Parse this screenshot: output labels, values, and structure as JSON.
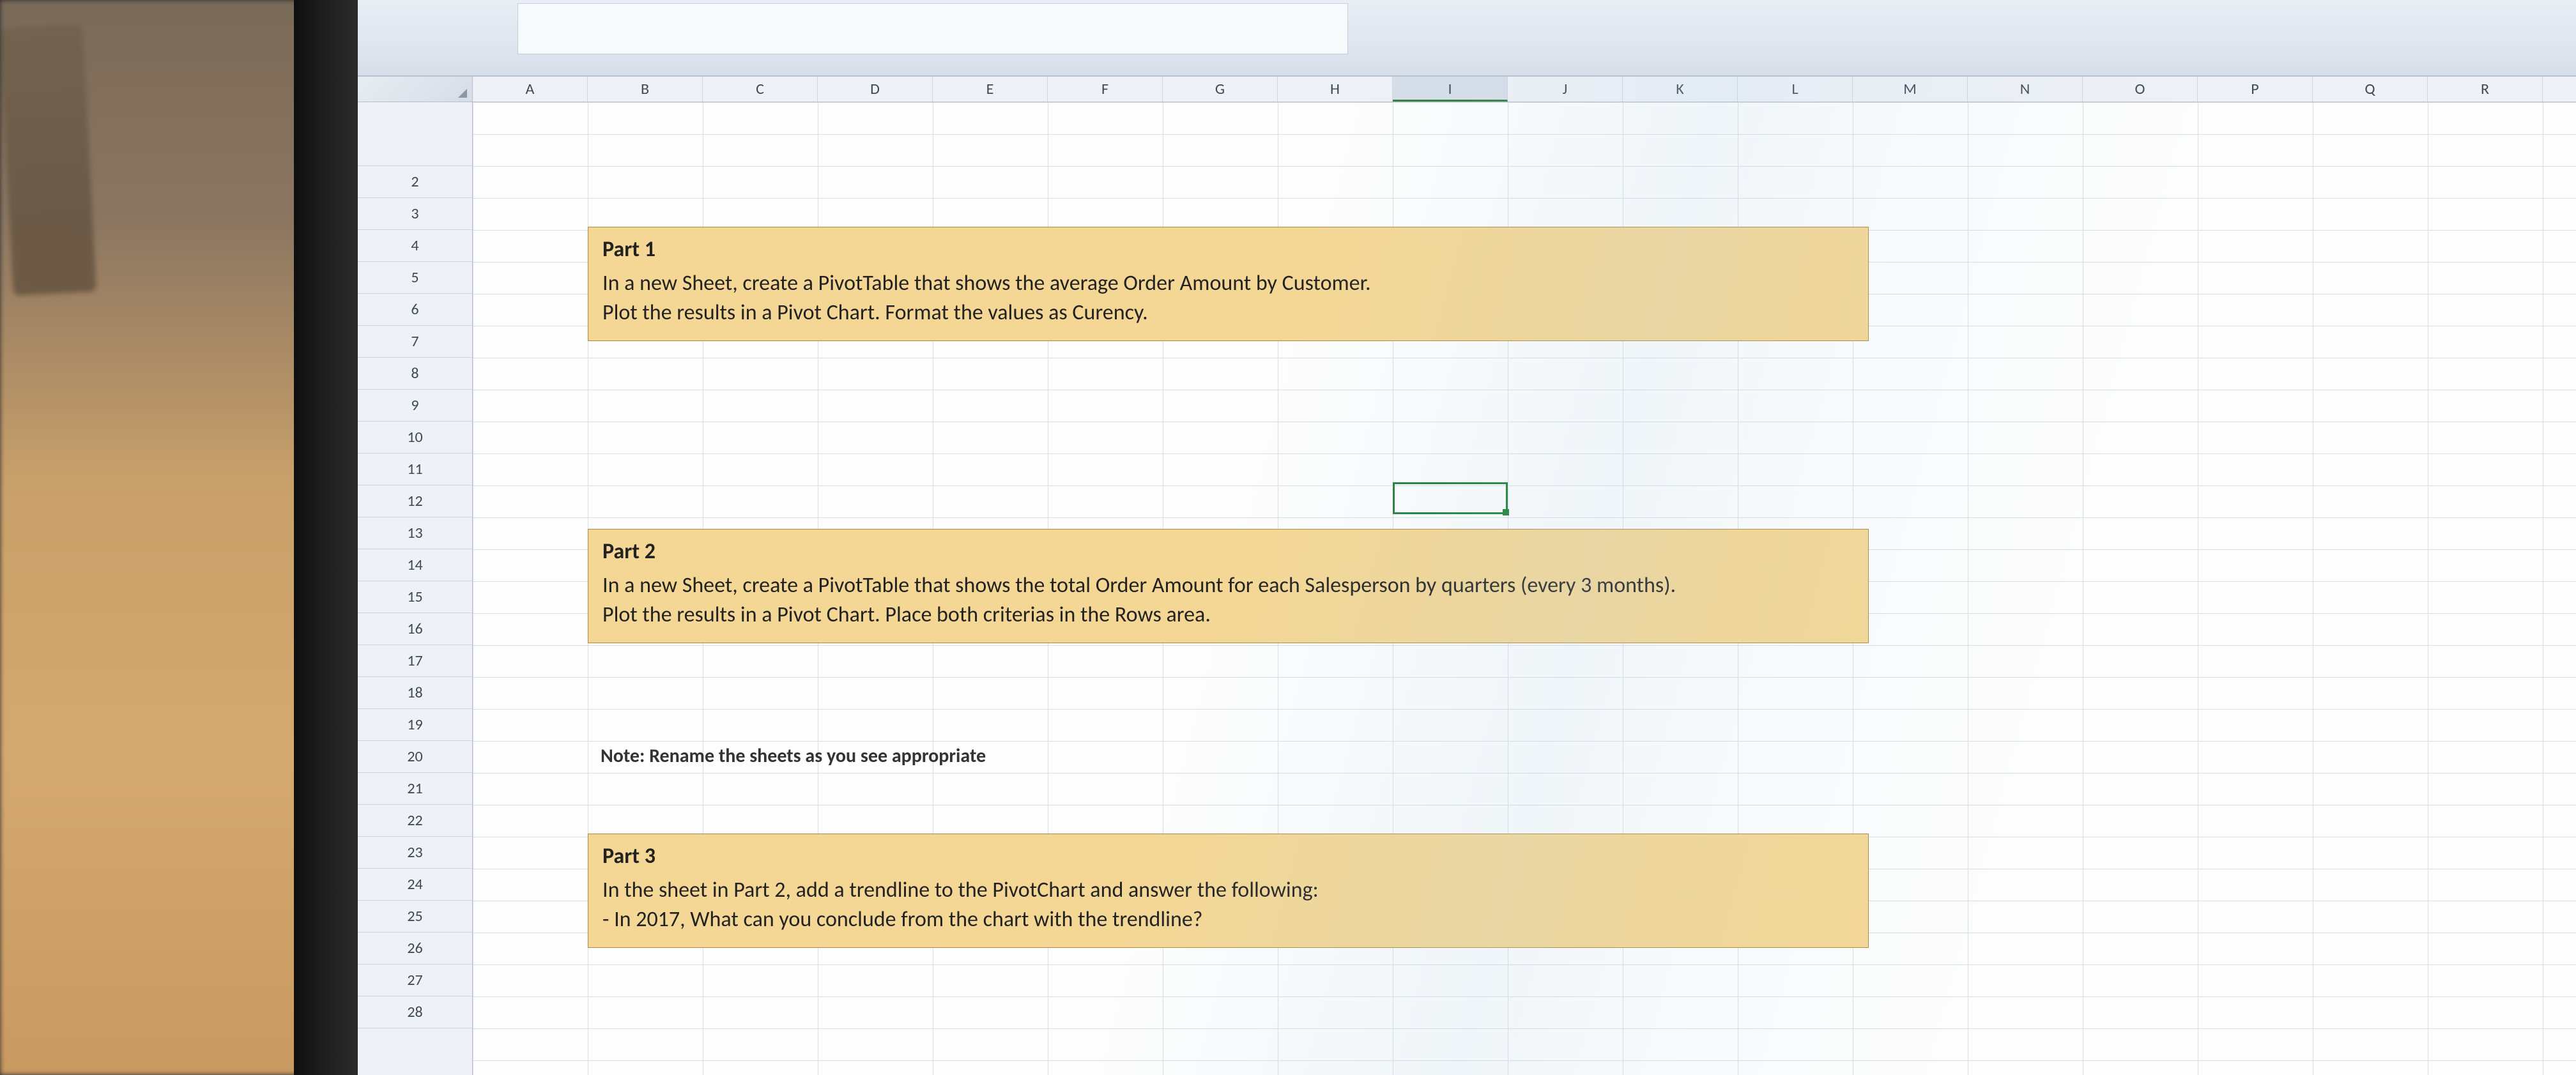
{
  "columns": [
    "A",
    "B",
    "C",
    "D",
    "E",
    "F",
    "G",
    "H",
    "I",
    "J",
    "K",
    "L",
    "M",
    "N",
    "O",
    "P",
    "Q",
    "R"
  ],
  "active_column_index": 8,
  "rows": [
    2,
    3,
    4,
    5,
    6,
    7,
    8,
    9,
    10,
    11,
    12,
    13,
    14,
    15,
    16,
    17,
    18,
    19,
    20,
    21,
    22,
    23,
    24,
    25,
    26,
    27,
    28
  ],
  "part1": {
    "title": "Part 1",
    "body": "In a new Sheet, create a PivotTable that shows the average Order Amount by Customer.\nPlot the results in a Pivot Chart. Format the values as Curency."
  },
  "part2": {
    "title": "Part 2",
    "body": "In a new Sheet, create a PivotTable that shows the total Order Amount for each Salesperson by quarters (every 3 months).\nPlot the results in a Pivot Chart. Place both criterias in the Rows area."
  },
  "note": "Note: Rename the sheets as you see appropriate",
  "part3": {
    "title": "Part 3",
    "body": "In the sheet in Part 2, add a trendline to the PivotChart and answer the following:\n- In 2017, What can you conclude from the chart with the trendline?"
  }
}
